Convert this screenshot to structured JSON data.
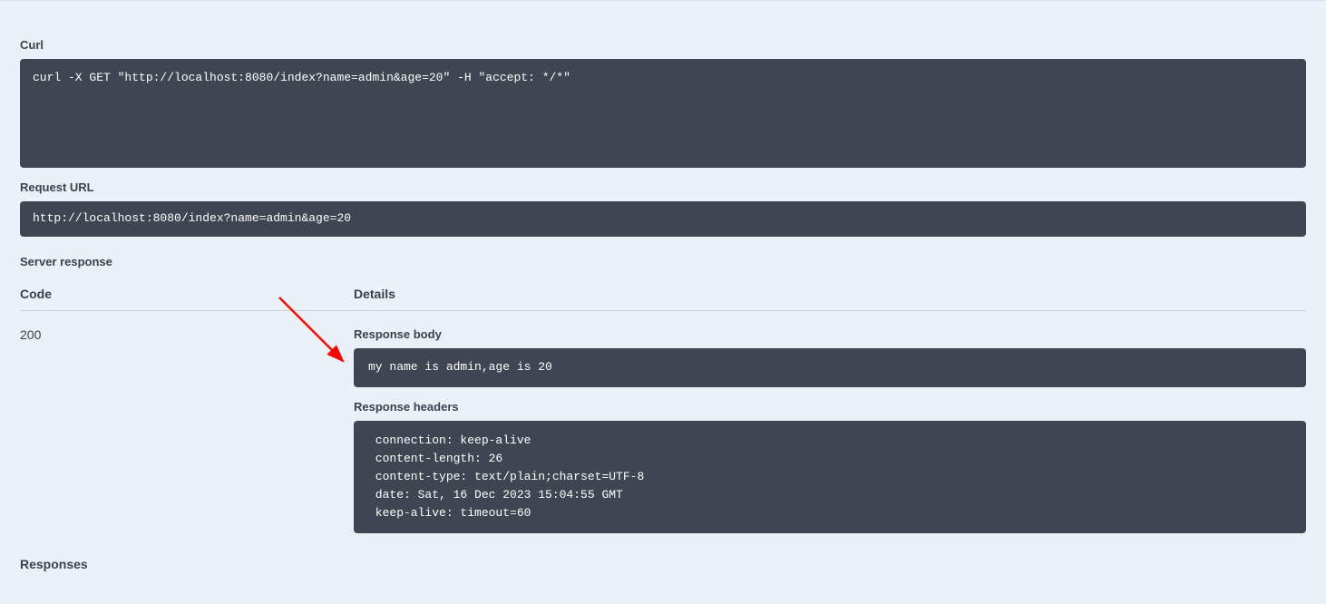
{
  "curl": {
    "label": "Curl",
    "command": "curl -X GET \"http://localhost:8080/index?name=admin&age=20\" -H \"accept: */*\""
  },
  "request_url": {
    "label": "Request URL",
    "value": "http://localhost:8080/index?name=admin&age=20"
  },
  "server_response": {
    "label": "Server response",
    "columns": {
      "code": "Code",
      "details": "Details"
    },
    "code": "200",
    "response_body": {
      "label": "Response body",
      "value": "my name is admin,age is 20"
    },
    "response_headers": {
      "label": "Response headers",
      "lines": [
        " connection: keep-alive ",
        " content-length: 26 ",
        " content-type: text/plain;charset=UTF-8 ",
        " date: Sat, 16 Dec 2023 15:04:55 GMT ",
        " keep-alive: timeout=60 "
      ]
    }
  },
  "responses_section_label": "Responses"
}
